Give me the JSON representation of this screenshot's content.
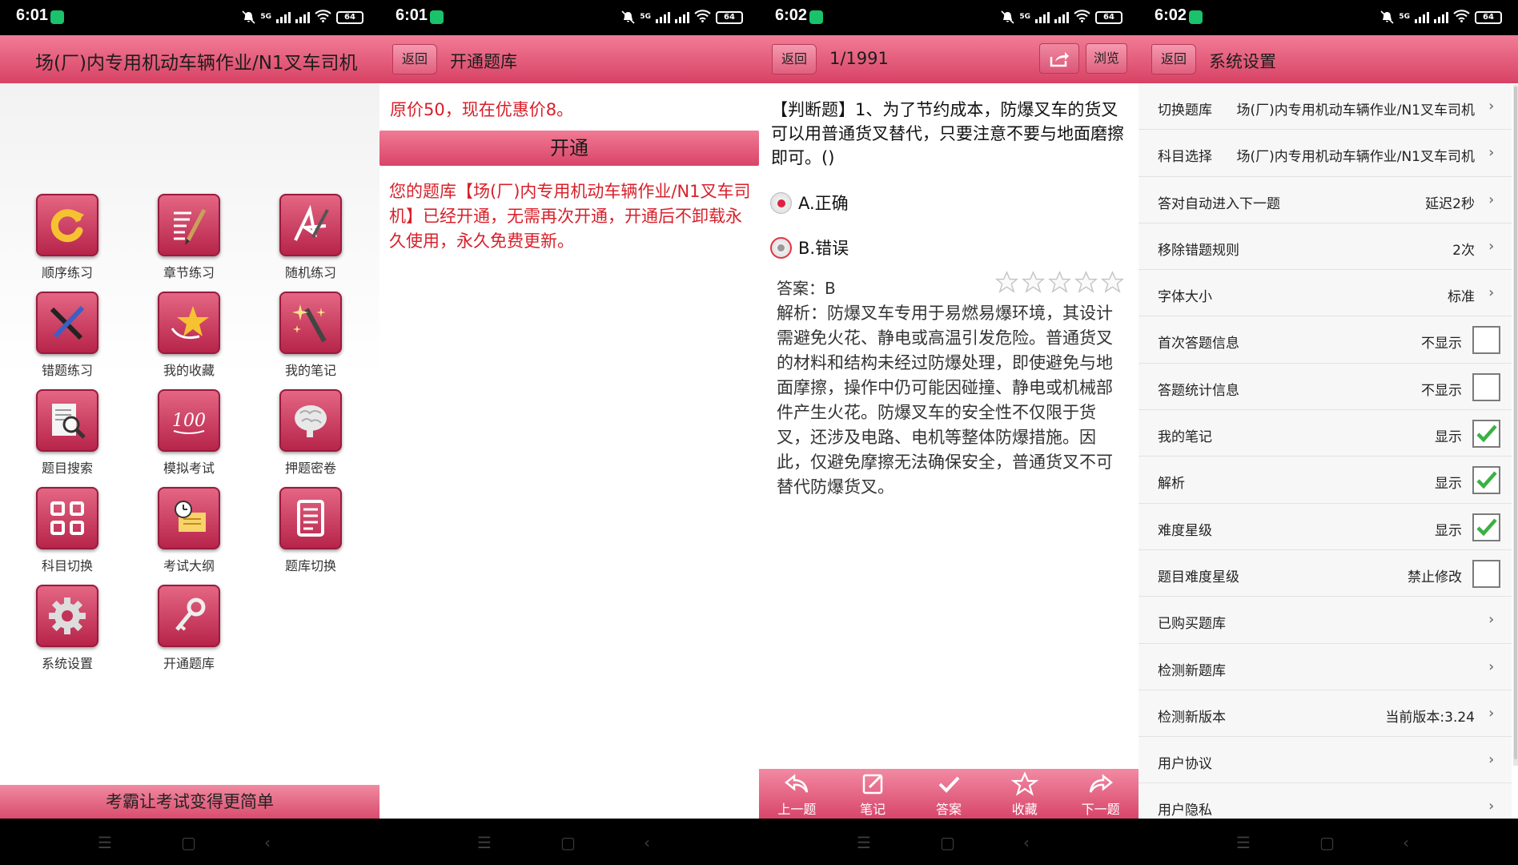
{
  "status": [
    {
      "time": "6:01",
      "net": "5G",
      "battery": "64"
    },
    {
      "time": "6:01",
      "net": "5G",
      "battery": "64"
    },
    {
      "time": "6:02",
      "net": "5G",
      "battery": "64"
    },
    {
      "time": "6:02",
      "net": "5G",
      "battery": "64"
    }
  ],
  "home": {
    "title": "场(厂)内专用机动车辆作业/N1叉车司机",
    "items": [
      {
        "label": "顺序练习",
        "icon": "refresh-icon"
      },
      {
        "label": "章节练习",
        "icon": "list-pen-icon"
      },
      {
        "label": "随机练习",
        "icon": "random-pen-icon"
      },
      {
        "label": "错题练习",
        "icon": "cross-pen-icon"
      },
      {
        "label": "我的收藏",
        "icon": "star-icon"
      },
      {
        "label": "我的笔记",
        "icon": "magic-wand-icon"
      },
      {
        "label": "题目搜索",
        "icon": "search-list-icon"
      },
      {
        "label": "模拟考试",
        "icon": "score-100-icon"
      },
      {
        "label": "押题密卷",
        "icon": "brain-icon"
      },
      {
        "label": "科目切换",
        "icon": "grid-icon"
      },
      {
        "label": "考试大纲",
        "icon": "syllabus-icon"
      },
      {
        "label": "题库切换",
        "icon": "document-icon"
      },
      {
        "label": "系统设置",
        "icon": "gear-icon"
      },
      {
        "label": "开通题库",
        "icon": "key-icon"
      }
    ],
    "footer": "考霸让考试变得更简单"
  },
  "open": {
    "back": "返回",
    "title": "开通题库",
    "price": "原价50，现在优惠价8。",
    "button": "开通",
    "message": "您的题库【场(厂)内专用机动车辆作业/N1叉车司机】已经开通，无需再次开通，开通后不卸载永久使用，永久免费更新。"
  },
  "question": {
    "back": "返回",
    "counter": "1/1991",
    "browse": "浏览",
    "text": "【判断题】1、为了节约成本，防爆叉车的货叉可以用普通货叉替代，只要注意不要与地面磨擦即可。()",
    "options": [
      "A.正确",
      "B.错误"
    ],
    "answer": "答案：B",
    "stars": 0,
    "analysis": "解析：防爆叉车专用于易燃易爆环境，其设计需避免火花、静电或高温引发危险。普通货叉的材料和结构未经过防爆处理，即使避免与地面摩擦，操作中仍可能因碰撞、静电或机械部件产生火花。防爆叉车的安全性不仅限于货叉，还涉及电路、电机等整体防爆措施。因此，仅避免摩擦无法确保安全，普通货叉不可替代防爆货叉。",
    "bottom": [
      "上一题",
      "笔记",
      "答案",
      "收藏",
      "下一题"
    ]
  },
  "settings": {
    "back": "返回",
    "title": "系统设置",
    "rows": [
      {
        "label": "切换题库",
        "value": "场(厂)内专用机动车辆作业/N1叉车司机",
        "type": "chevron"
      },
      {
        "label": "科目选择",
        "value": "场(厂)内专用机动车辆作业/N1叉车司机",
        "type": "chevron"
      },
      {
        "label": "答对自动进入下一题",
        "value": "延迟2秒",
        "type": "chevron"
      },
      {
        "label": "移除错题规则",
        "value": "2次",
        "type": "chevron"
      },
      {
        "label": "字体大小",
        "value": "标准",
        "type": "chevron"
      },
      {
        "label": "首次答题信息",
        "value": "不显示",
        "type": "checkbox",
        "checked": false
      },
      {
        "label": "答题统计信息",
        "value": "不显示",
        "type": "checkbox",
        "checked": false
      },
      {
        "label": "我的笔记",
        "value": "显示",
        "type": "checkbox",
        "checked": true
      },
      {
        "label": "解析",
        "value": "显示",
        "type": "checkbox",
        "checked": true
      },
      {
        "label": "难度星级",
        "value": "显示",
        "type": "checkbox",
        "checked": true
      },
      {
        "label": "题目难度星级",
        "value": "禁止修改",
        "type": "checkbox",
        "checked": false
      },
      {
        "label": "已购买题库",
        "value": "",
        "type": "chevron"
      },
      {
        "label": "检测新题库",
        "value": "",
        "type": "chevron"
      },
      {
        "label": "检测新版本",
        "value": "当前版本:3.24",
        "type": "chevron"
      },
      {
        "label": "用户协议",
        "value": "",
        "type": "chevron"
      },
      {
        "label": "用户隐私",
        "value": "",
        "type": "chevron"
      }
    ]
  },
  "colors": {
    "accent": "#d84264",
    "alert_text": "#d8202a",
    "check": "#3cb043"
  }
}
